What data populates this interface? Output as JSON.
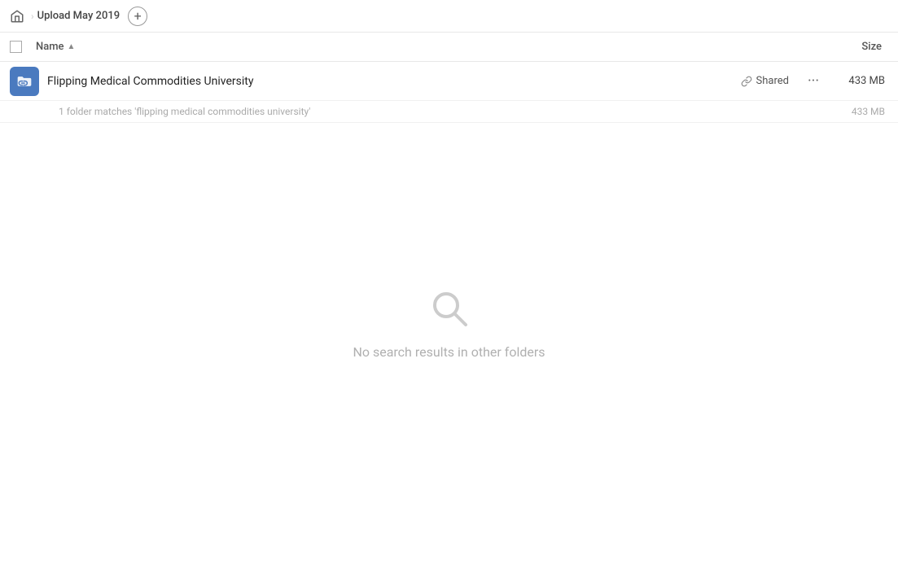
{
  "topbar": {
    "home_icon": "home-icon",
    "breadcrumb_text": "Upload May 2019",
    "add_btn_label": "+"
  },
  "columns": {
    "checkbox_label": "",
    "name_label": "Name",
    "sort_direction": "▲",
    "size_label": "Size"
  },
  "file_row": {
    "icon_type": "link-folder-icon",
    "name": "Flipping Medical Commodities University",
    "shared_label": "Shared",
    "more_label": "···",
    "size": "433 MB"
  },
  "match_info": {
    "text": "1 folder matches 'flipping medical commodities university'",
    "size": "433 MB"
  },
  "no_results": {
    "icon": "search-empty-icon",
    "text": "No search results in other folders"
  }
}
